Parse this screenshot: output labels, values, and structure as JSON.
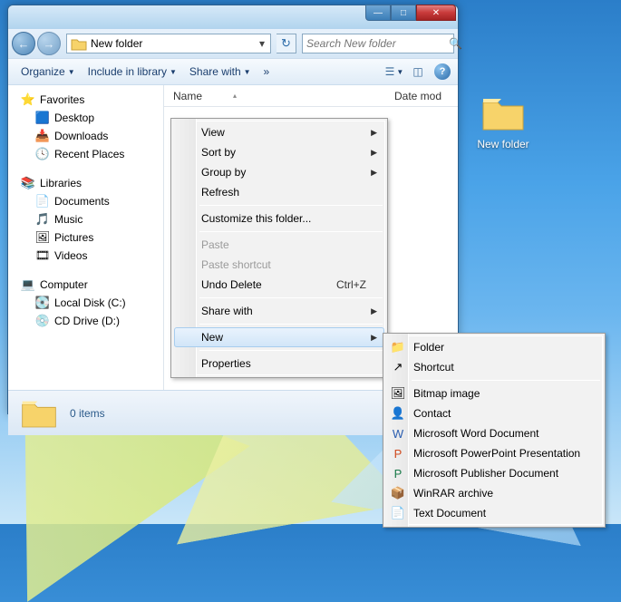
{
  "desktop": {
    "folder_label": "New folder"
  },
  "window": {
    "address": "New folder",
    "search_placeholder": "Search New folder",
    "toolbar": {
      "organize": "Organize",
      "include": "Include in library",
      "share": "Share with",
      "more": "»"
    },
    "columns": {
      "name": "Name",
      "date": "Date mod"
    },
    "status": "0 items"
  },
  "sidebar": {
    "favorites": "Favorites",
    "desktop": "Desktop",
    "downloads": "Downloads",
    "recent": "Recent Places",
    "libraries": "Libraries",
    "documents": "Documents",
    "music": "Music",
    "pictures": "Pictures",
    "videos": "Videos",
    "computer": "Computer",
    "localdisk": "Local Disk (C:)",
    "cddrive": "CD Drive (D:)"
  },
  "context1": {
    "view": "View",
    "sortby": "Sort by",
    "groupby": "Group by",
    "refresh": "Refresh",
    "customize": "Customize this folder...",
    "paste": "Paste",
    "pasteshortcut": "Paste shortcut",
    "undodelete": "Undo Delete",
    "undodelete_key": "Ctrl+Z",
    "sharewith": "Share with",
    "new": "New",
    "properties": "Properties"
  },
  "context2": {
    "folder": "Folder",
    "shortcut": "Shortcut",
    "bitmap": "Bitmap image",
    "contact": "Contact",
    "word": "Microsoft Word Document",
    "ppt": "Microsoft PowerPoint Presentation",
    "pub": "Microsoft Publisher Document",
    "winrar": "WinRAR archive",
    "text": "Text Document"
  }
}
